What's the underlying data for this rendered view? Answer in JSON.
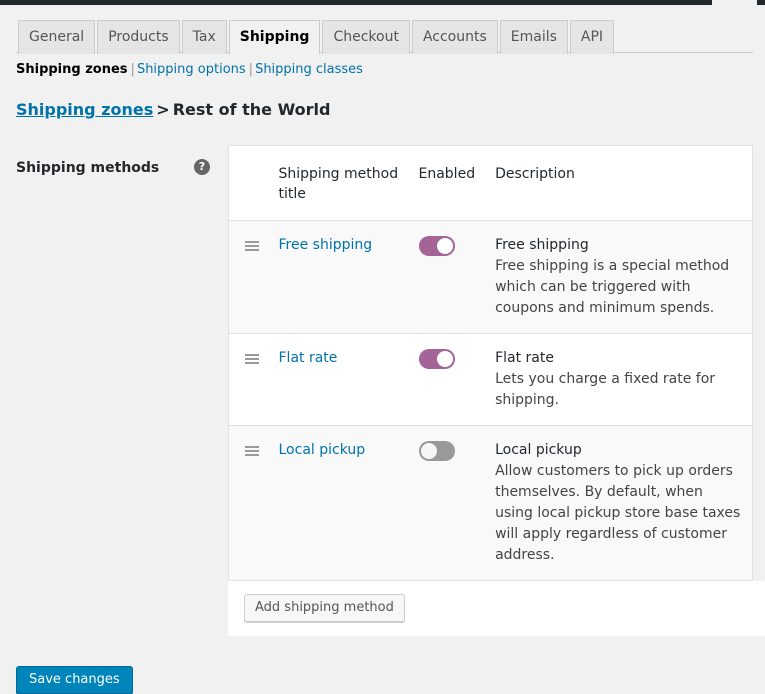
{
  "tabs": [
    {
      "label": "General",
      "active": false
    },
    {
      "label": "Products",
      "active": false
    },
    {
      "label": "Tax",
      "active": false
    },
    {
      "label": "Shipping",
      "active": true
    },
    {
      "label": "Checkout",
      "active": false
    },
    {
      "label": "Accounts",
      "active": false
    },
    {
      "label": "Emails",
      "active": false
    },
    {
      "label": "API",
      "active": false
    }
  ],
  "subnav": {
    "items": [
      {
        "label": "Shipping zones",
        "current": true
      },
      {
        "label": "Shipping options",
        "current": false
      },
      {
        "label": "Shipping classes",
        "current": false
      }
    ],
    "separator": "|"
  },
  "breadcrumb": {
    "parent_link": "Shipping zones",
    "separator": ">",
    "current": "Rest of the World"
  },
  "settings_row": {
    "label": "Shipping methods",
    "help_icon": "help-question-icon",
    "help_glyph": "?"
  },
  "table": {
    "headers": {
      "sort": "",
      "title": "Shipping method title",
      "enabled": "Enabled",
      "description": "Description"
    },
    "rows": [
      {
        "sort_icon": "drag-handle-icon",
        "title": "Free shipping",
        "enabled": true,
        "desc_title": "Free shipping",
        "desc_body": "Free shipping is a special method which can be triggered with coupons and minimum spends."
      },
      {
        "sort_icon": "drag-handle-icon",
        "title": "Flat rate",
        "enabled": true,
        "desc_title": "Flat rate",
        "desc_body": "Lets you charge a fixed rate for shipping."
      },
      {
        "sort_icon": "drag-handle-icon",
        "title": "Local pickup",
        "enabled": false,
        "desc_title": "Local pickup",
        "desc_body": "Allow customers to pick up orders themselves. By default, when using local pickup store base taxes will apply regardless of customer address."
      }
    ],
    "add_method_label": "Add shipping method"
  },
  "actions": {
    "save_label": "Save changes"
  },
  "colors": {
    "link": "#0073aa",
    "toggle_on": "#a46497",
    "toggle_off": "#999999",
    "primary_button": "#0085ba",
    "page_background": "#f1f1f1"
  }
}
